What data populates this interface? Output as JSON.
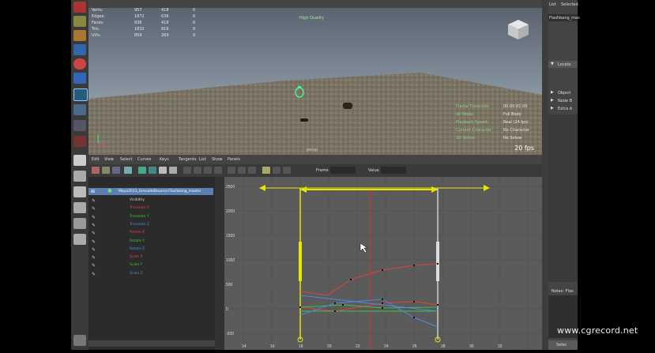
{
  "hud_stats": {
    "rows": [
      {
        "label": "Verts:",
        "a": "957",
        "b": "418",
        "c": "0"
      },
      {
        "label": "Edges:",
        "a": "1872",
        "b": "636",
        "c": "0"
      },
      {
        "label": "Faces:",
        "a": "936",
        "b": "418",
        "c": "0"
      },
      {
        "label": "Tris:",
        "a": "1832",
        "b": "816",
        "c": "0"
      },
      {
        "label": "UVs:",
        "a": "859",
        "b": "269",
        "c": "0"
      }
    ],
    "quality": "High Quality"
  },
  "hud_right": {
    "rows": [
      {
        "label": "Frame Timecode:",
        "value": "00:00:01:00"
      },
      {
        "label": "Ik/ Mode:",
        "value": "Full Body"
      },
      {
        "label": "Playback Speed:",
        "value": "Real (24 fps)"
      },
      {
        "label": "Current Character:",
        "value": "No Character"
      },
      {
        "label": "3D Solver:",
        "value": "No Solver"
      }
    ],
    "fps": "20 fps",
    "persp": "persp"
  },
  "graph_editor": {
    "menu": [
      "Edit",
      "View",
      "Select",
      "Curves",
      "Keys",
      "Tangents",
      "List",
      "Show",
      "Panels"
    ],
    "frame_label": "Frame",
    "value_label": "Value",
    "outliner_root": "Maya2013_GrenadeBounce:Flashbang_master",
    "channels": [
      {
        "name": "Visibility",
        "color": "#d0d0d0"
      },
      {
        "name": "Translate X",
        "color": "#e04040"
      },
      {
        "name": "Translate Y",
        "color": "#40c040"
      },
      {
        "name": "Translate Z",
        "color": "#4a8ae0"
      },
      {
        "name": "Rotate X",
        "color": "#e04040"
      },
      {
        "name": "Rotate Y",
        "color": "#40c040"
      },
      {
        "name": "Rotate Z",
        "color": "#4a8ae0"
      },
      {
        "name": "Scale X",
        "color": "#e04040"
      },
      {
        "name": "Scale Y",
        "color": "#40c040"
      },
      {
        "name": "Scale Z",
        "color": "#4a8ae0"
      }
    ],
    "y_ticks": [
      "2500",
      "2000",
      "1500",
      "1000",
      "500",
      "0",
      "-500"
    ],
    "x_ticks": [
      "14",
      "16",
      "18",
      "20",
      "22",
      "24",
      "26",
      "28",
      "30",
      "32"
    ]
  },
  "right_panel": {
    "tabs": [
      "List",
      "Selected"
    ],
    "node": "Flashbang_mas",
    "section": "Locato",
    "items": [
      "Object",
      "Node B",
      "Extra A"
    ],
    "notes": "Notes: Flas",
    "select_btn": "Selec"
  },
  "watermark": "www.cgrecord.net",
  "colors": {
    "accent_yellow": "#e6e600",
    "hud_green": "#9cf09c"
  }
}
